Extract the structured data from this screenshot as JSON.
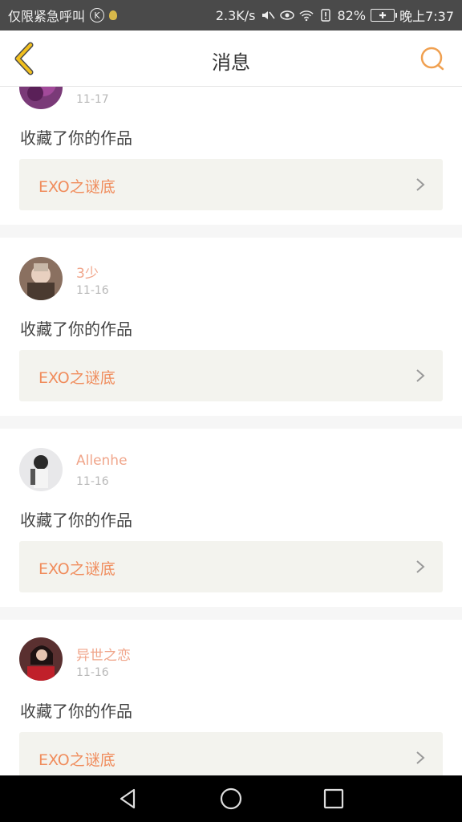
{
  "status_bar": {
    "carrier": "仅限紧急呼叫",
    "k_badge": "K",
    "speed": "2.3K/s",
    "battery_pct": "82%",
    "time": "晚上7:37",
    "icons": [
      "mute-icon",
      "eye-icon",
      "wifi-icon",
      "alert-icon",
      "battery-icon"
    ]
  },
  "header": {
    "title": "消息",
    "back_icon": "chevron-left-icon",
    "search_icon": "search-icon",
    "accent": "#f0b020"
  },
  "messages": [
    {
      "user": "",
      "date": "11-17",
      "action": "收藏了你的作品",
      "work": "EXO之谜底"
    },
    {
      "user": "3少",
      "date": "11-16",
      "action": "收藏了你的作品",
      "work": "EXO之谜底"
    },
    {
      "user": "Allenhe",
      "date": "11-16",
      "action": "收藏了你的作品",
      "work": "EXO之谜底"
    },
    {
      "user": "异世之恋",
      "date": "11-16",
      "action": "收藏了你的作品",
      "work": "EXO之谜底"
    }
  ],
  "nav": {
    "back": "nav-back-icon",
    "home": "nav-home-icon",
    "recents": "nav-recents-icon"
  }
}
